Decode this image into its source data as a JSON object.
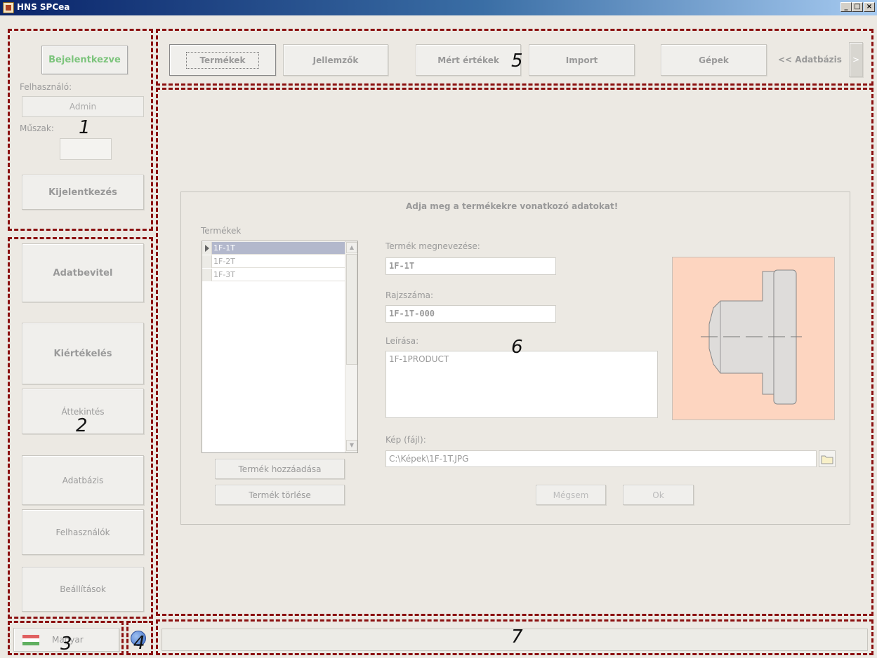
{
  "window": {
    "title": "HNS SPCea",
    "minimize": "_",
    "maximize": "□",
    "close": "×"
  },
  "login": {
    "status_button": "Bejelentkezve",
    "user_label": "Felhasználó:",
    "user_value": "Admin",
    "shift_label": "Műszak:",
    "shift_value": "",
    "logout_button": "Kijelentkezés"
  },
  "nav": {
    "data_entry": "Adatbevitel",
    "evaluation": "Kiértékelés",
    "overview": "Áttekintés",
    "database": "Adatbázis",
    "users": "Felhasználók",
    "settings": "Beállítások"
  },
  "language": {
    "label": "Magyar"
  },
  "tabs": {
    "products": "Termékek",
    "characteristics": "Jellemzők",
    "measured_values": "Mért értékek",
    "import": "Import",
    "machines": "Gépek",
    "database_label": "<< Adatbázis",
    "next": ">"
  },
  "form": {
    "heading": "Adja meg a termékekre vonatkozó adatokat!",
    "products_label": "Termékek",
    "products": [
      "1F-1T",
      "1F-2T",
      "1F-3T"
    ],
    "selected_index": 0,
    "name_label": "Termék megnevezése:",
    "name_value": "1F-1T",
    "drawing_label": "Rajzszáma:",
    "drawing_value": "1F-1T-000",
    "description_label": "Leírása:",
    "description_value": "1F-1PRODUCT",
    "image_label": "Kép (fájl):",
    "image_path": "C:\\Képek\\1F-1T.JPG",
    "add_button": "Termék hozzáadása",
    "delete_button": "Termék törlése",
    "cancel_button": "Mégsem",
    "ok_button": "Ok"
  },
  "annotations": {
    "r1": "1",
    "r2": "2",
    "r3": "3",
    "r4": "4",
    "r5": "5",
    "r6": "6",
    "r7": "7"
  },
  "colors": {
    "region_outline": "#8b1010",
    "logged_in_text": "#7cc47c",
    "selection": "#b3b8cc",
    "image_background": "#fdd5c0"
  }
}
